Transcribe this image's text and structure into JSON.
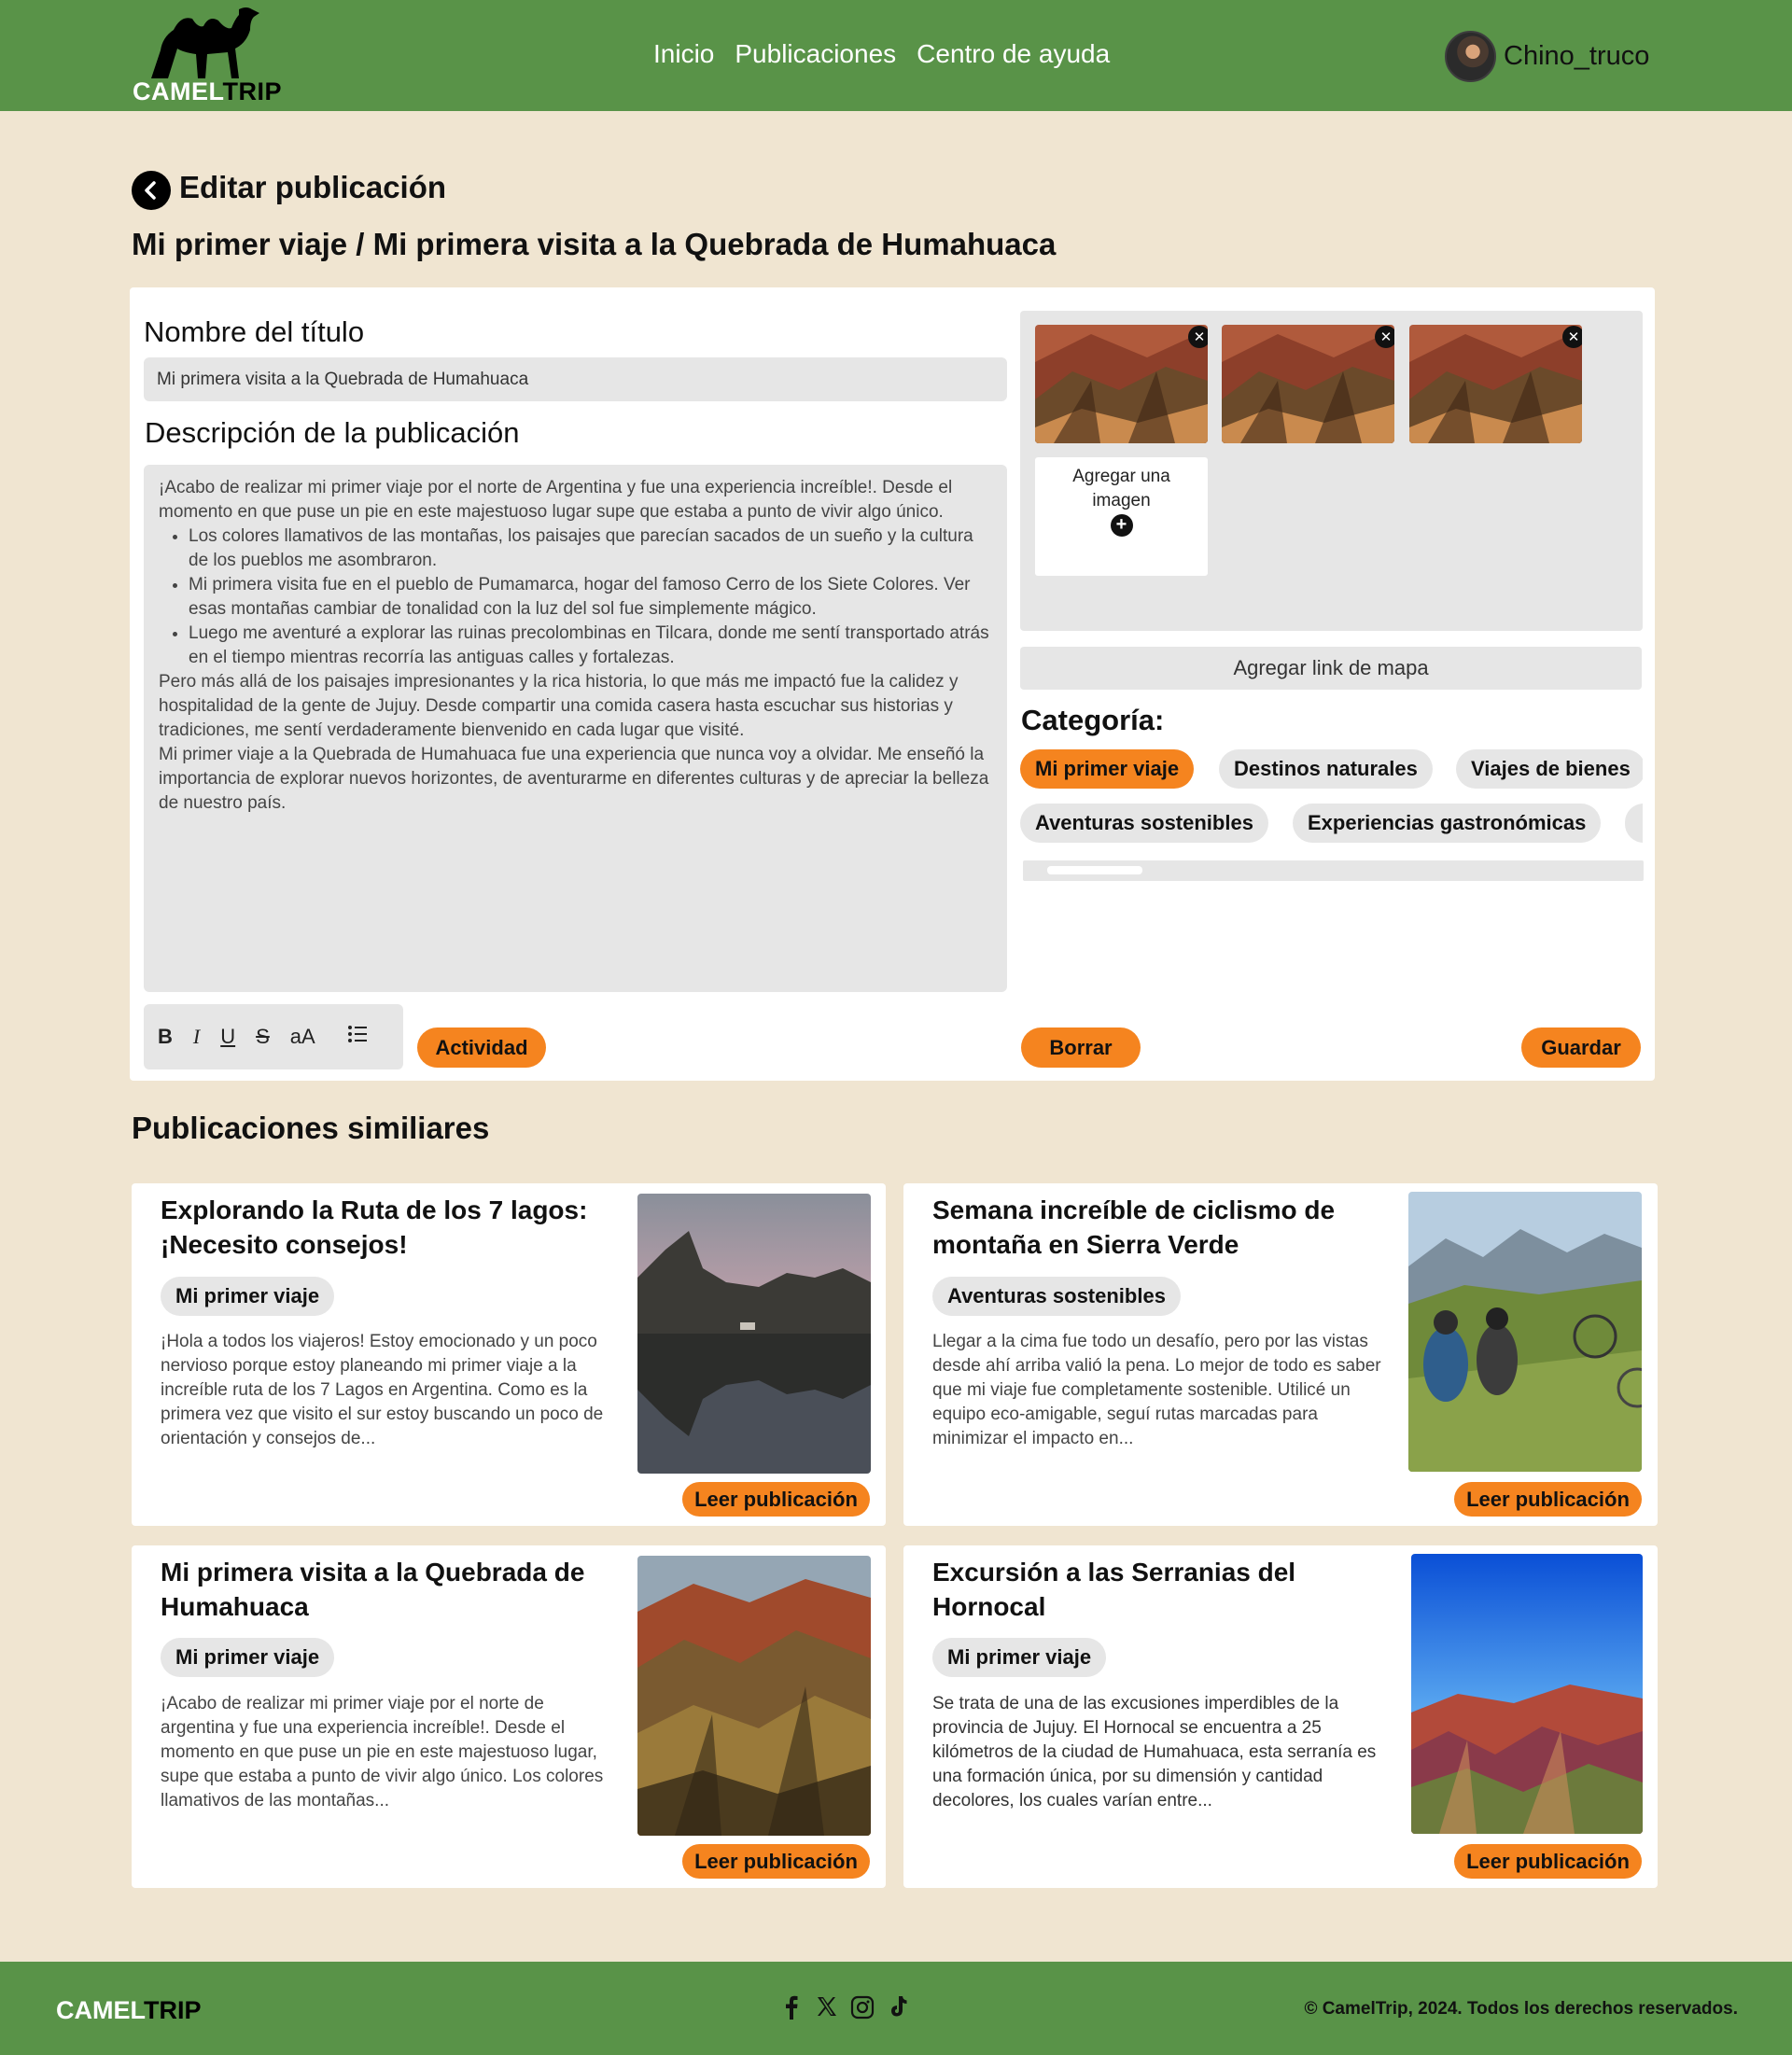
{
  "brand": {
    "name_light": "CAMEL",
    "name_dark": "TRIP"
  },
  "nav": {
    "items": [
      "Inicio",
      "Publicaciones",
      "Centro de ayuda"
    ]
  },
  "user": {
    "name": "Chino_truco"
  },
  "page": {
    "heading": "Editar publicación",
    "subheading": "Mi primer viaje / Mi primera visita a la Quebrada de Humahuaca"
  },
  "editor": {
    "title_label": "Nombre del título",
    "title_value": "Mi primera visita a la Quebrada de Humahuaca",
    "desc_label": "Descripción de la publicación",
    "desc_intro": "¡Acabo de realizar mi primer viaje por el norte de Argentina y fue una experiencia increíble!. Desde el momento en que puse un pie en este majestuoso lugar supe que estaba a punto de vivir algo único.",
    "desc_bullets": [
      "Los colores llamativos de las montañas, los paisajes que parecían sacados de un sueño y la cultura de los pueblos me asombraron.",
      "Mi primera visita fue en el pueblo de Pumamarca, hogar del famoso Cerro de los Siete Colores. Ver esas montañas cambiar de tonalidad con la luz del sol fue simplemente mágico.",
      " Luego me aventuré a explorar las ruinas precolombinas en Tilcara, donde me sentí transportado atrás en el tiempo mientras recorría las antiguas calles y fortalezas."
    ],
    "desc_p2": "Pero más allá de los paisajes impresionantes y la rica historia, lo que más me impactó fue la calidez y hospitalidad de la gente de Jujuy. Desde compartir una comida casera hasta escuchar sus historias y tradiciones, me sentí verdaderamente bienvenido en cada lugar que visité.",
    "desc_p3": "Mi primer viaje a la Quebrada de Humahuaca fue una experiencia que nunca voy a olvidar. Me enseñó la importancia de explorar nuevos horizontes, de aventurarme en diferentes culturas y de apreciar la belleza de nuestro país.",
    "toolbar": {
      "bold": "B",
      "italic": "I",
      "underline": "U",
      "strike": "S",
      "case": "aA"
    },
    "activity_label": "Actividad",
    "delete_label": "Borrar",
    "save_label": "Guardar",
    "add_image_label": "Agregar una imagen",
    "map_link_label": "Agregar link de mapa",
    "category_label": "Categoría:",
    "categories_row1": [
      "Mi primer viaje",
      "Destinos naturales",
      "Viajes de bienes"
    ],
    "categories_row2": [
      "Aventuras sostenibles",
      "Experiencias gastronómicas",
      ""
    ],
    "selected_category": "Mi primer viaje"
  },
  "similar": {
    "heading": "Publicaciones similiares",
    "read_label": "Leer publicación",
    "cards": [
      {
        "title": "Explorando la Ruta de los 7 lagos: ¡Necesito consejos!",
        "tag": "Mi primer viaje",
        "text": "¡Hola a todos los viajeros! Estoy emocionado y un poco nervioso porque estoy planeando mi primer viaje a la increíble ruta de los 7 Lagos en Argentina. Como es la primera vez que visito el sur estoy buscando un poco de orientación y consejos de..."
      },
      {
        "title": "Semana increíble de ciclismo de montaña en Sierra Verde",
        "tag": "Aventuras sostenibles",
        "text": "Llegar a la cima fue todo un desafío, pero por las vistas desde ahí arriba valió la pena. Lo mejor de todo es saber que mi viaje fue completamente sostenible. Utilicé un equipo eco-amigable, seguí rutas marcadas para minimizar el impacto en..."
      },
      {
        "title": "Mi primera visita a la Quebrada de Humahuaca",
        "tag": "Mi primer viaje",
        "text": "¡Acabo de realizar mi primer viaje por el norte de argentina y fue una experiencia increíble!. Desde el momento en que puse un pie en este majestuoso lugar, supe que estaba a punto de vivir algo único. Los colores llamativos de las montañas..."
      },
      {
        "title": "Excursión a las Serranias del Hornocal",
        "tag": "Mi primer viaje",
        "text": "Se trata de una de las excusiones imperdibles de la provincia de Jujuy. El Hornocal se encuentra a 25 kilómetros de la ciudad de Humahuaca, esta serranía es una formación única, por su dimensión y cantidad decolores, los cuales varían entre..."
      }
    ]
  },
  "footer": {
    "copyright": "© CamelTrip, 2024. Todos los derechos reservados."
  },
  "colors": {
    "header_green": "#599348",
    "accent_orange": "#f5841f",
    "page_bg": "#f0e5d1",
    "field_gray": "#e6e6e6"
  }
}
